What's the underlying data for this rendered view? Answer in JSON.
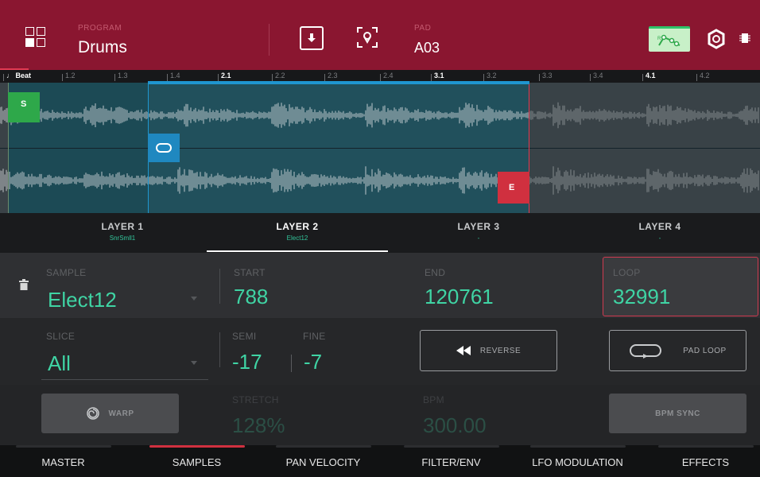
{
  "header": {
    "program_label": "PROGRAM",
    "program_value": "Drums",
    "pad_label": "PAD",
    "pad_value": "A03",
    "icons": [
      "menu-grid-icon",
      "download-icon",
      "locate-icon",
      "envelope-icon",
      "gear-icon",
      "chip-icon"
    ]
  },
  "ruler": {
    "beat_label": "♩ Beat",
    "ticks": [
      "1.2",
      "1.3",
      "1.4",
      "2.1",
      "2.2",
      "2.3",
      "2.4",
      "3.1",
      "3.2",
      "3.3",
      "3.4",
      "4.1",
      "4.2"
    ]
  },
  "waveform": {
    "start_marker": "S",
    "end_marker": "E"
  },
  "layers": [
    {
      "name": "LAYER 1",
      "sample": "SnrSmll1"
    },
    {
      "name": "LAYER 2",
      "sample": "Elect12"
    },
    {
      "name": "LAYER 3",
      "sample": "-"
    },
    {
      "name": "LAYER 4",
      "sample": "-"
    }
  ],
  "params": {
    "sample_label": "SAMPLE",
    "sample_value": "Elect12",
    "start_label": "START",
    "start_value": "788",
    "end_label": "END",
    "end_value": "120761",
    "loop_label": "LOOP",
    "loop_value": "32991",
    "slice_label": "SLICE",
    "slice_value": "All",
    "semi_label": "SEMI",
    "semi_value": "-17",
    "fine_label": "FINE",
    "fine_value": "-7",
    "reverse_label": "REVERSE",
    "pad_loop_label": "PAD LOOP",
    "warp_label": "WARP",
    "stretch_label": "STRETCH",
    "stretch_value": "128%",
    "bpm_label": "BPM",
    "bpm_value": "300.00",
    "bpm_sync_label": "BPM SYNC"
  },
  "tabs": [
    "MASTER",
    "SAMPLES",
    "PAN VELOCITY",
    "FILTER/ENV",
    "LFO MODULATION",
    "EFFECTS"
  ],
  "colors": {
    "header": "#8a1630",
    "accent_green": "#3fd4a4",
    "loop_blue": "#1f96d0",
    "end_red": "#d0303f"
  }
}
